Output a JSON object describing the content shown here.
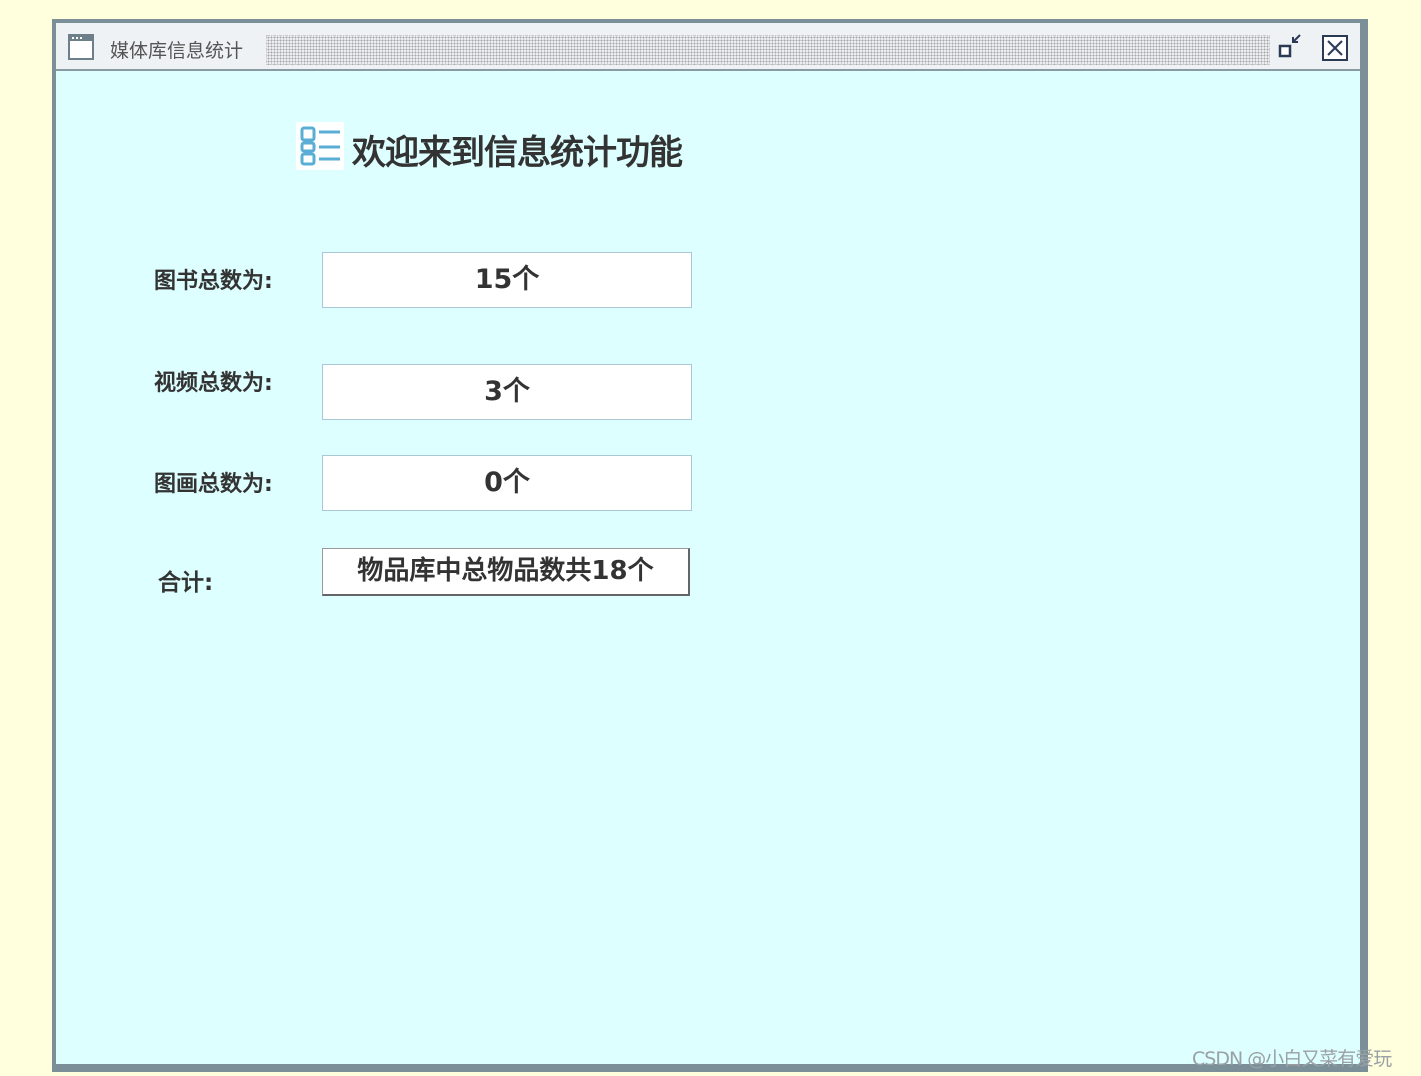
{
  "window": {
    "title": "媒体库信息统计",
    "title_icon": "window-icon",
    "restore_icon": "restore-icon",
    "close_icon": "close-icon"
  },
  "main": {
    "heading": "欢迎来到信息统计功能",
    "heading_icon": "list-icon",
    "rows": [
      {
        "label": "图书总数为:",
        "value": "15个"
      },
      {
        "label": "视频总数为:",
        "value": "3个"
      },
      {
        "label": "图画总数为:",
        "value": "0个"
      }
    ],
    "total": {
      "label": "合计:",
      "value": "物品库中总物品数共18个"
    }
  },
  "watermark": "CSDN @小白又菜有爱玩",
  "colors": {
    "page_background": "#ffffde",
    "window_background": "#ddffff",
    "frame": "#7a8f98",
    "text": "#333333",
    "icon_accent": "#5aaed6"
  }
}
